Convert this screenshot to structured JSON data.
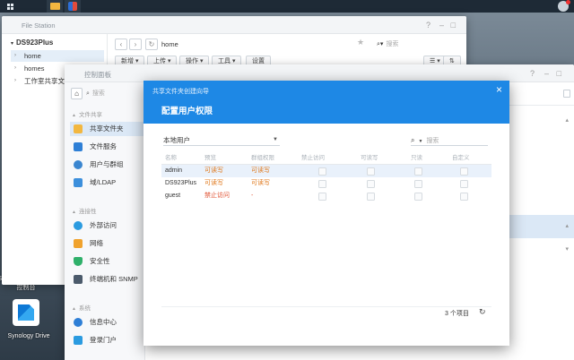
{
  "colors": {
    "accent": "#1e88e5",
    "read_write": "#e07a1f",
    "no_access": "#e05030"
  },
  "desktop": {
    "icon_label_1": "Synology Drive 管理控制台",
    "icon_label_2": "Synology Drive"
  },
  "file_station": {
    "title": "File Station",
    "root": "DS923Plus",
    "tree": [
      "home",
      "homes",
      "工作室共享文件"
    ],
    "path": "home",
    "search_placeholder": "搜索",
    "toolbar": [
      "新增",
      "上传",
      "操作",
      "工具",
      "设置"
    ]
  },
  "control_panel": {
    "title": "控制面板",
    "search_placeholder": "搜索",
    "sections": [
      {
        "label": "文件共享",
        "items": [
          "共享文件夹",
          "文件服务",
          "用户与群组",
          "域/LDAP"
        ]
      },
      {
        "label": "连接性",
        "items": [
          "外部访问",
          "网络",
          "安全性",
          "终端机和 SNMP"
        ]
      },
      {
        "label": "系统",
        "items": [
          "信息中心",
          "登录门户"
        ]
      }
    ]
  },
  "dialog": {
    "title": "共享文件夹创建向导",
    "subtitle": "配置用户权限",
    "filter_value": "本地用户",
    "search_placeholder": "搜索",
    "columns": [
      "名称",
      "预览",
      "群组权限",
      "禁止访问",
      "可读写",
      "只读",
      "自定义"
    ],
    "rows": [
      {
        "name": "admin",
        "preview": "可读写",
        "group": "可读写"
      },
      {
        "name": "DS923Plus",
        "preview": "可读写",
        "group": "可读写"
      },
      {
        "name": "guest",
        "preview": "禁止访问",
        "group": "-"
      }
    ],
    "count": "3 个项目"
  }
}
